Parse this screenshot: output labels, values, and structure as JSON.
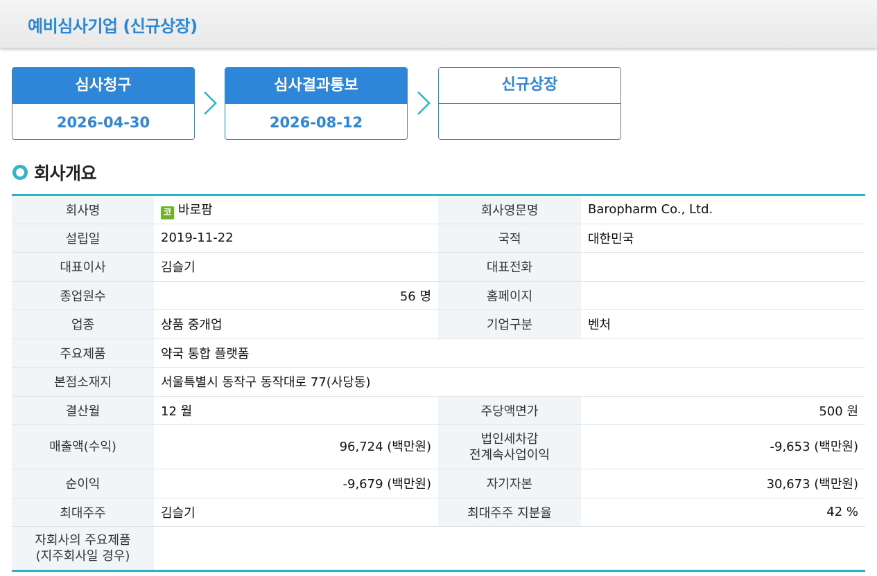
{
  "header": {
    "title": "예비심사기업 (신규상장)"
  },
  "steps": [
    {
      "label": "심사청구",
      "date": "2026-04-30"
    },
    {
      "label": "심사결과통보",
      "date": "2026-08-12"
    },
    {
      "label": "신규상장",
      "date": ""
    }
  ],
  "section": {
    "title": "회사개요"
  },
  "market_badge": {
    "text": "코",
    "color": "#6fb22a"
  },
  "company": {
    "name_label": "회사명",
    "name": "바로팜",
    "eng_name_label": "회사영문명",
    "eng_name": "Baropharm Co., Ltd.",
    "founded_label": "설립일",
    "founded": "2019-11-22",
    "country_label": "국적",
    "country": "대한민국",
    "ceo_label": "대표이사",
    "ceo": "김슬기",
    "phone_label": "대표전화",
    "phone": "",
    "employees_label": "종업원수",
    "employees": "56 명",
    "homepage_label": "홈페이지",
    "homepage": "",
    "industry_label": "업종",
    "industry": "상품 중개업",
    "company_type_label": "기업구분",
    "company_type": "벤처",
    "products_label": "주요제품",
    "products": "약국 통합 플랫폼",
    "address_label": "본점소재지",
    "address": "서울특별시 동작구 동작대로 77(사당동)",
    "fiscal_month_label": "결산월",
    "fiscal_month": "12 월",
    "par_value_label": "주당액면가",
    "par_value": "500 원",
    "revenue_label": "매출액(수익)",
    "revenue": "96,724 (백만원)",
    "pretax_label_line1": "법인세차감",
    "pretax_label_line2": "전계속사업이익",
    "pretax": "-9,653 (백만원)",
    "net_income_label": "순이익",
    "net_income": "-9,679 (백만원)",
    "equity_label": "자기자본",
    "equity": "30,673 (백만원)",
    "largest_holder_label": "최대주주",
    "largest_holder": "김슬기",
    "holder_share_label": "최대주주 지분율",
    "holder_share": "42 %",
    "subsidiary_label_line1": "자회사의 주요제품",
    "subsidiary_label_line2": "(지주회사일 경우)",
    "subsidiary_products": ""
  },
  "colors": {
    "accent": "#2e86d8",
    "teal": "#29b3c9",
    "label_bg": "#f2f5f8"
  }
}
